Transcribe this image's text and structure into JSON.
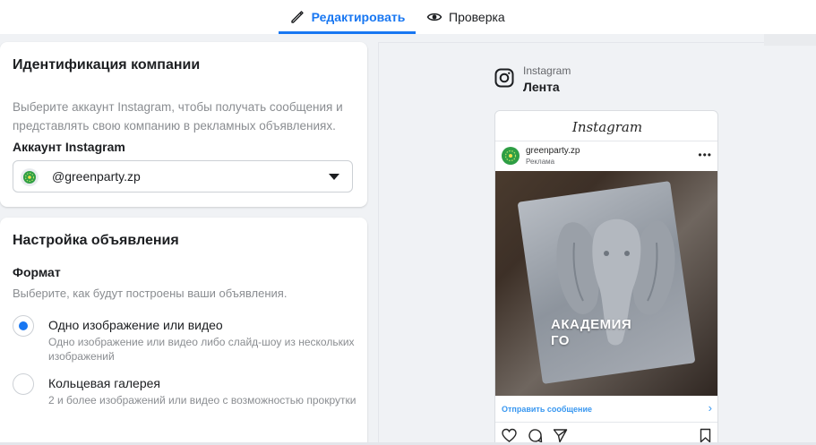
{
  "tabs": {
    "edit_label": "Редактировать",
    "review_label": "Проверка"
  },
  "identity": {
    "title": "Идентификация компании",
    "description": "Выберите аккаунт Instagram, чтобы получать сообщения и представлять свою компанию в рекламных объявлениях.",
    "account_label": "Аккаунт Instagram",
    "account_value": "@greenparty.zp"
  },
  "ad_setup": {
    "title": "Настройка объявления",
    "format_label": "Формат",
    "format_description": "Выберите, как будут построены ваши объявления.",
    "options": [
      {
        "title": "Одно изображение или видео",
        "description": "Одно изображение или видео либо слайд-шоу из нескольких изображений",
        "selected": true
      },
      {
        "title": "Кольцевая галерея",
        "description": "2 и более изображений или видео с возможностью прокрутки",
        "selected": false
      }
    ]
  },
  "preview": {
    "platform": "Instagram",
    "placement": "Лента",
    "app_brand": "Instagram",
    "username": "greenparty.zp",
    "sponsored": "Реклама",
    "overlay_line1": "АКАДЕМИЯ",
    "overlay_line2": "ГО",
    "cta": "Отправить сообщение"
  },
  "colors": {
    "accent": "#1877f2",
    "instagram_link": "#3897f0"
  },
  "icons": {
    "edit": "pencil-icon",
    "review": "eye-icon",
    "dropdown": "caret-down-icon",
    "platform": "instagram-icon",
    "more": "more-dots-icon",
    "cta_arrow": "chevron-right-icon",
    "like": "heart-icon",
    "comment": "comment-icon",
    "share": "send-icon",
    "save": "bookmark-icon"
  }
}
